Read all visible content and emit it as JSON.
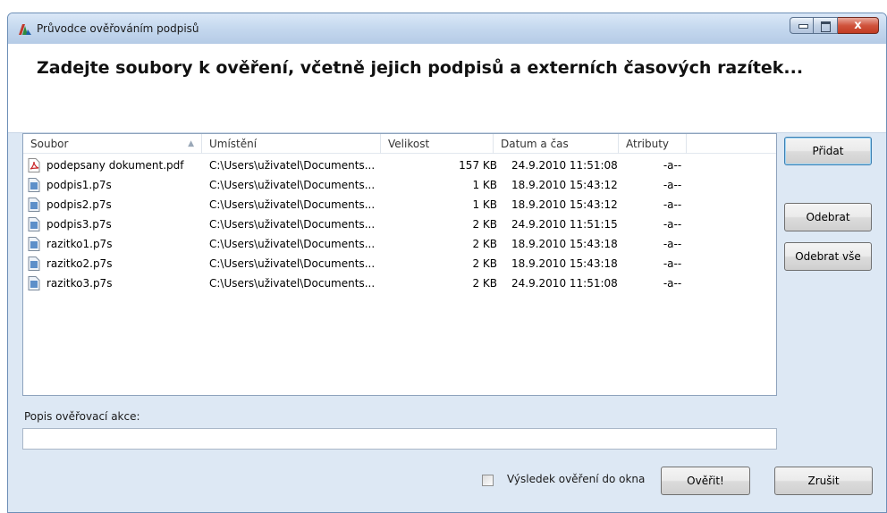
{
  "window": {
    "title": "Průvodce ověřováním podpisů",
    "close_glyph": "x"
  },
  "heading": "Zadejte soubory k ověření, včetně jejich podpisů a externích časových razítek...",
  "table": {
    "columns": [
      "Soubor",
      "Umístění",
      "Velikost",
      "Datum a čas",
      "Atributy"
    ],
    "rows": [
      {
        "icon": "pdf-icon",
        "name": "podepsany dokument.pdf",
        "location": "C:\\Users\\uživatel\\Documents...",
        "size": "157 KB",
        "date": "24.9.2010 11:51:08",
        "attr": "-a--"
      },
      {
        "icon": "file-icon",
        "name": "podpis1.p7s",
        "location": "C:\\Users\\uživatel\\Documents...",
        "size": "1 KB",
        "date": "18.9.2010 15:43:12",
        "attr": "-a--"
      },
      {
        "icon": "file-icon",
        "name": "podpis2.p7s",
        "location": "C:\\Users\\uživatel\\Documents...",
        "size": "1 KB",
        "date": "18.9.2010 15:43:12",
        "attr": "-a--"
      },
      {
        "icon": "file-icon",
        "name": "podpis3.p7s",
        "location": "C:\\Users\\uživatel\\Documents...",
        "size": "2 KB",
        "date": "24.9.2010 11:51:15",
        "attr": "-a--"
      },
      {
        "icon": "file-icon",
        "name": "razitko1.p7s",
        "location": "C:\\Users\\uživatel\\Documents...",
        "size": "2 KB",
        "date": "18.9.2010 15:43:18",
        "attr": "-a--"
      },
      {
        "icon": "file-icon",
        "name": "razitko2.p7s",
        "location": "C:\\Users\\uživatel\\Documents...",
        "size": "2 KB",
        "date": "18.9.2010 15:43:18",
        "attr": "-a--"
      },
      {
        "icon": "file-icon",
        "name": "razitko3.p7s",
        "location": "C:\\Users\\uživatel\\Documents...",
        "size": "2 KB",
        "date": "24.9.2010 11:51:08",
        "attr": "-a--"
      }
    ]
  },
  "side_buttons": {
    "add": "Přidat",
    "remove": "Odebrat",
    "remove_all": "Odebrat vše"
  },
  "description": {
    "label": "Popis ověřovací akce:",
    "value": ""
  },
  "footer": {
    "checkbox_label": "Výsledek ověření do okna",
    "checkbox_checked": false,
    "verify": "Ověřit!",
    "cancel": "Zrušit"
  }
}
